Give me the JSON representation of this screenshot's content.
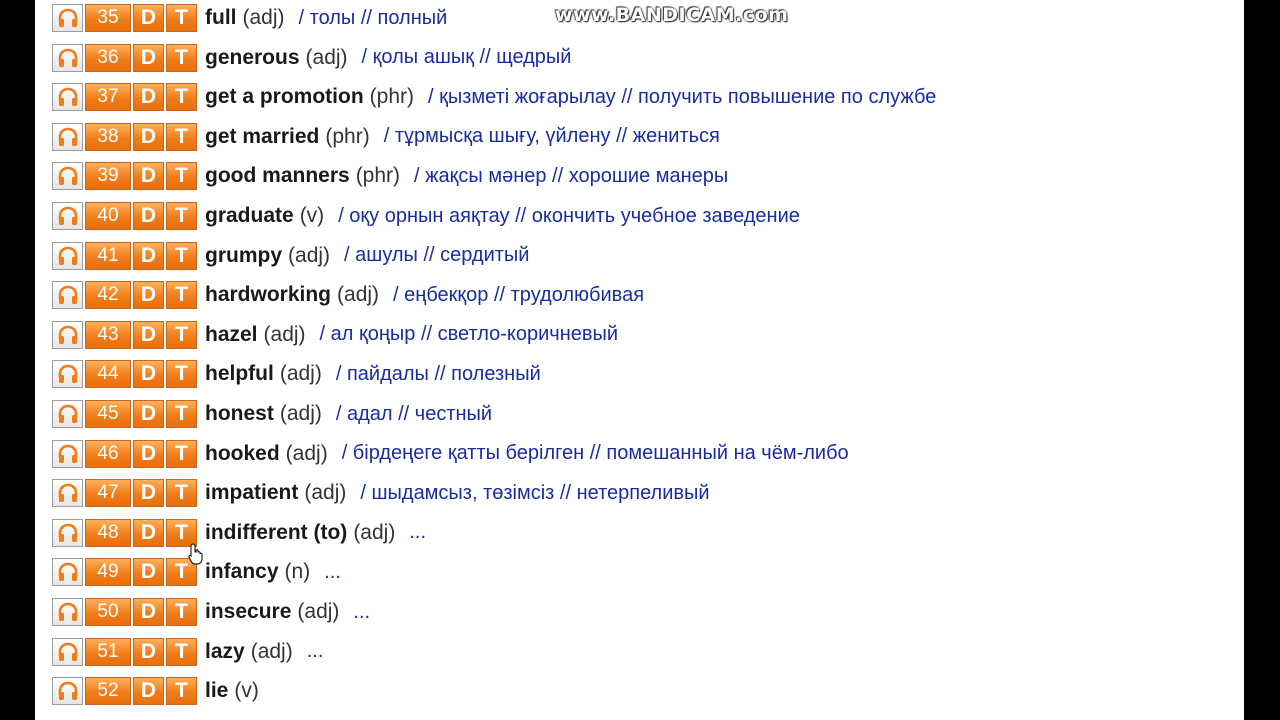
{
  "watermark": "www.BANDICAM.com",
  "entries": [
    {
      "num": "35",
      "d": "D",
      "t": "T",
      "word": "full",
      "pos": "(adj)",
      "tr": "/ толы // полный"
    },
    {
      "num": "36",
      "d": "D",
      "t": "T",
      "word": "generous",
      "pos": "(adj)",
      "tr": "/ қолы ашық // щедрый"
    },
    {
      "num": "37",
      "d": "D",
      "t": "T",
      "word": "get a promotion",
      "pos": "(phr)",
      "tr": "/ қызметі жоғарылау // получить повышение по службе"
    },
    {
      "num": "38",
      "d": "D",
      "t": "T",
      "word": "get married",
      "pos": "(phr)",
      "tr": "/ тұрмысқа шығу, үйлену // жениться"
    },
    {
      "num": "39",
      "d": "D",
      "t": "T",
      "word": "good manners",
      "pos": "(phr)",
      "tr": "/ жақсы мәнер // хорошие манеры"
    },
    {
      "num": "40",
      "d": "D",
      "t": "T",
      "word": "graduate",
      "pos": "(v)",
      "tr": "/ оқу орнын аяқтау // окончить учебное заведение"
    },
    {
      "num": "41",
      "d": "D",
      "t": "T",
      "word": "grumpy",
      "pos": "(adj)",
      "tr": "/ ашулы // сердитый"
    },
    {
      "num": "42",
      "d": "D",
      "t": "T",
      "word": "hardworking",
      "pos": "(adj)",
      "tr": "/ еңбекқор // трудолюбивая"
    },
    {
      "num": "43",
      "d": "D",
      "t": "T",
      "word": "hazel",
      "pos": "(adj)",
      "tr": "/ ал қоңыр // светло-коричневый"
    },
    {
      "num": "44",
      "d": "D",
      "t": "T",
      "word": "helpful",
      "pos": "(adj)",
      "tr": "/ пайдалы // полезный"
    },
    {
      "num": "45",
      "d": "D",
      "t": "T",
      "word": "honest",
      "pos": "(adj)",
      "tr": "/ адал // честный"
    },
    {
      "num": "46",
      "d": "D",
      "t": "T",
      "word": "hooked",
      "pos": "(adj)",
      "tr": "/ бірдеңеге қатты берілген // помешанный на чём-либо"
    },
    {
      "num": "47",
      "d": "D",
      "t": "T",
      "word": "impatient",
      "pos": "(adj)",
      "tr": "/ шыдамсыз, төзімсіз // нетерпеливый"
    },
    {
      "num": "48",
      "d": "D",
      "t": "T",
      "word": "indifferent (to)",
      "pos": "(adj)",
      "tr": "..."
    },
    {
      "num": "49",
      "d": "D",
      "t": "T",
      "word": "infancy",
      "pos": "(n)",
      "tr": "..."
    },
    {
      "num": "50",
      "d": "D",
      "t": "T",
      "word": "insecure",
      "pos": "(adj)",
      "tr": "..."
    },
    {
      "num": "51",
      "d": "D",
      "t": "T",
      "word": "lazy",
      "pos": "(adj)",
      "tr": "..."
    },
    {
      "num": "52",
      "d": "D",
      "t": "T",
      "word": "lie",
      "pos": "(v)",
      "tr": ""
    }
  ]
}
